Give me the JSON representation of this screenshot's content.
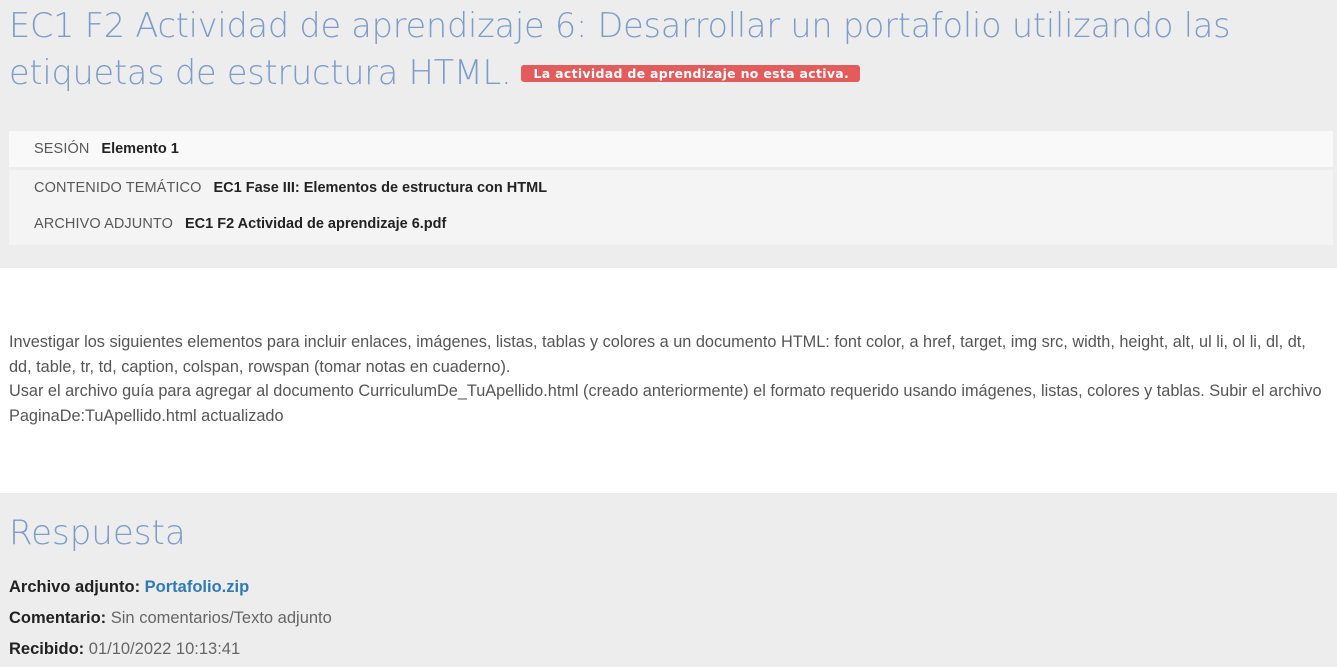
{
  "activity": {
    "title": "EC1 F2 Actividad de aprendizaje 6: Desarrollar un portafolio utilizando las etiquetas de estructura HTML.",
    "status_badge": "La actividad de aprendizaje no esta activa.",
    "status_color": "#e35b5b",
    "accent_color": "#7c9cc9"
  },
  "info": {
    "session_label": "SESIÓN",
    "session_value": "Elemento 1",
    "topic_label": "CONTENIDO TEMÁTICO",
    "topic_value": "EC1 Fase III: Elementos de estructura con HTML",
    "attachment_label": "ARCHIVO ADJUNTO",
    "attachment_value": "EC1 F2 Actividad de aprendizaje 6.pdf"
  },
  "description": {
    "paragraph_1": "Investigar los siguientes elementos para incluir enlaces, imágenes, listas, tablas y colores a un documento HTML: font color, a href, target, img src, width, height, alt, ul li, ol li, dl, dt, dd, table, tr, td, caption, colspan, rowspan (tomar notas en cuaderno).",
    "paragraph_2": "Usar el archivo guía para agregar al documento CurriculumDe_TuApellido.html (creado anteriormente) el formato requerido usando imágenes, listas, colores y tablas. Subir el archivo PaginaDe:TuApellido.html actualizado"
  },
  "response": {
    "title": "Respuesta",
    "file_label": "Archivo adjunto:",
    "file_name": "Portafolio.zip",
    "comment_label": "Comentario:",
    "comment_value": "Sin comentarios/Texto adjunto",
    "received_label": "Recibido:",
    "received_value": "01/10/2022 10:13:41",
    "link_color": "#2f7bb8"
  }
}
